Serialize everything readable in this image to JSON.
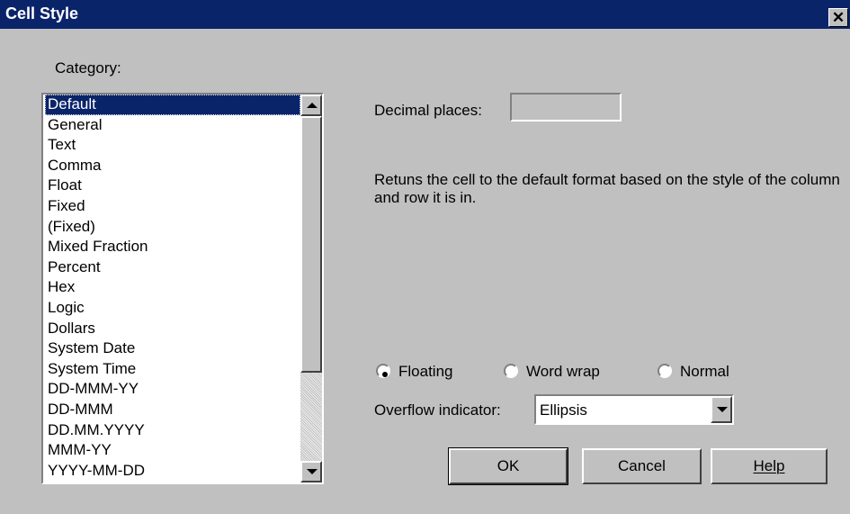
{
  "window": {
    "title": "Cell Style",
    "close_glyph": "✕"
  },
  "category": {
    "label": "Category:",
    "selected_index": 0,
    "items": [
      "Default",
      "General",
      "Text",
      "Comma",
      "Float",
      "Fixed",
      "(Fixed)",
      "Mixed Fraction",
      "Percent",
      "Hex",
      "Logic",
      "Dollars",
      "System Date",
      "System Time",
      "DD-MMM-YY",
      "DD-MMM",
      "DD.MM.YYYY",
      "MMM-YY",
      "YYYY-MM-DD"
    ]
  },
  "decimal": {
    "label": "Decimal places:",
    "value": ""
  },
  "description": "Retuns the cell to the default format based on the style of the column and row it is in.",
  "wrap_mode": {
    "options": [
      "Floating",
      "Word wrap",
      "Normal"
    ],
    "selected": "Floating"
  },
  "overflow": {
    "label": "Overflow indicator:",
    "value": "Ellipsis"
  },
  "buttons": {
    "ok": "OK",
    "cancel": "Cancel",
    "help": "Help"
  },
  "icons": {
    "close": "close-icon",
    "scroll_up": "arrow-up-icon",
    "scroll_down": "arrow-down-icon",
    "dropdown": "chevron-down-icon"
  },
  "colors": {
    "title_bar": "#0a246a",
    "face": "#c0c0c0",
    "selection": "#0a246a"
  }
}
